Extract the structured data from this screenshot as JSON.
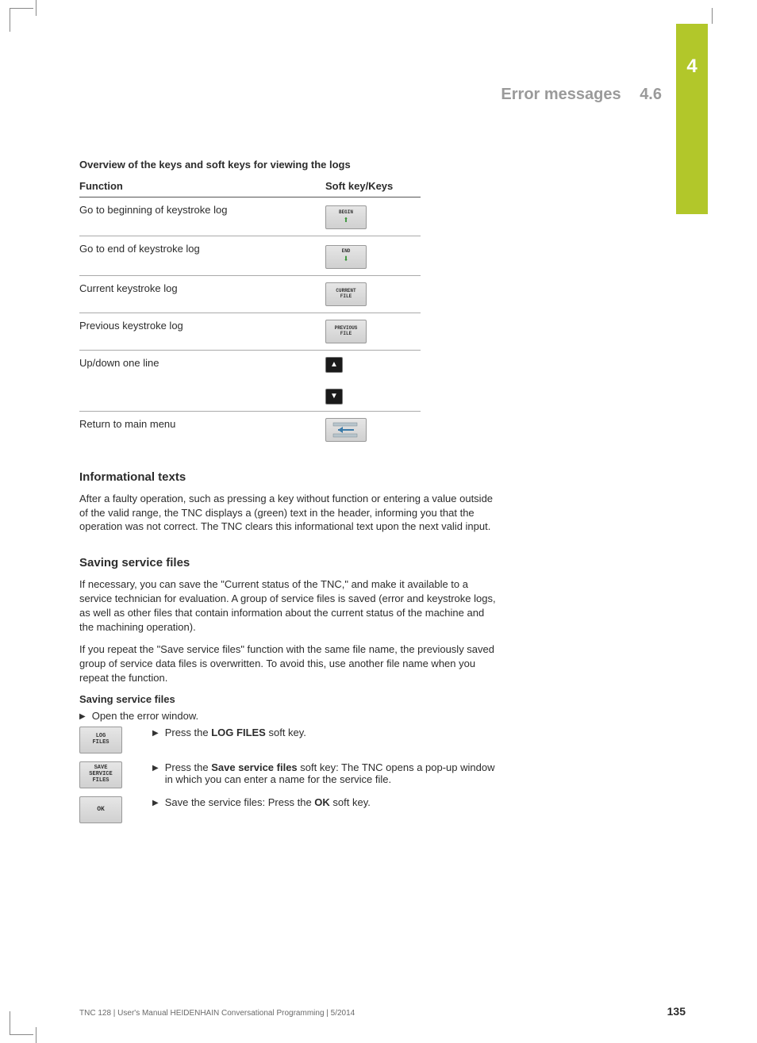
{
  "chapter_tab": "4",
  "header": {
    "title": "Error messages",
    "section": "4.6"
  },
  "table": {
    "title": "Overview of the keys and soft keys for viewing the logs",
    "col1": "Function",
    "col2": "Soft key/Keys",
    "rows": [
      {
        "func": "Go to beginning of keystroke log",
        "key_label": "BEGIN"
      },
      {
        "func": "Go to end of keystroke log",
        "key_label": "END"
      },
      {
        "func": "Current keystroke log",
        "key_label": "CURRENT\nFILE"
      },
      {
        "func": "Previous keystroke log",
        "key_label": "PREVIOUS\nFILE"
      },
      {
        "func": "Up/down one line"
      },
      {
        "func": "Return to main menu"
      }
    ]
  },
  "info": {
    "heading": "Informational texts",
    "body": "After a faulty operation, such as pressing a key without function or entering a value outside of the valid range, the TNC displays a (green) text in the header, informing you that the operation was not correct. The TNC clears this informational text upon the next valid input."
  },
  "save": {
    "heading": "Saving service files",
    "p1": "If necessary, you can save the \"Current status of the TNC,\" and make it available to a service technician for evaluation. A group of service files is saved (error and keystroke logs, as well as other files that contain information about the current status of the machine and the machining operation).",
    "p2": "If you repeat the \"Save service files\" function with the same file name, the previously saved group of service data files is overwritten. To avoid this, use another file name when you repeat the function.",
    "sub": "Saving service files",
    "step0": "Open the error window.",
    "step1_pre": "Press the ",
    "step1_bold": "LOG FILES",
    "step1_post": " soft key.",
    "key1": "LOG\nFILES",
    "step2_pre": "Press the ",
    "step2_bold": "Save service files",
    "step2_post": " soft key: The TNC opens a pop-up window in which you can enter a name for the service file.",
    "key2": "SAVE\nSERVICE\nFILES",
    "step3_pre": "Save the service files: Press the ",
    "step3_bold": "OK",
    "step3_post": " soft key.",
    "key3": "OK"
  },
  "footer": {
    "text": "TNC 128 | User's Manual HEIDENHAIN Conversational Programming | 5/2014",
    "page": "135"
  }
}
